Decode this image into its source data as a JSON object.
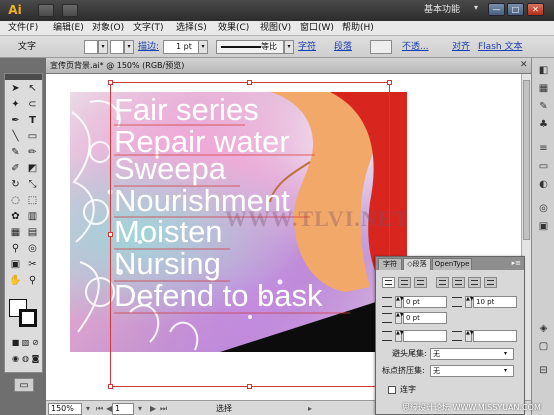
{
  "app": {
    "logo": "Ai",
    "workspace": "基本功能",
    "window_buttons": [
      "—",
      "□",
      "✕"
    ]
  },
  "menu": [
    "文件(F)",
    "编辑(E)",
    "对象(O)",
    "文字(T)",
    "选择(S)",
    "效果(C)",
    "视图(V)",
    "窗口(W)",
    "帮助(H)"
  ],
  "control_bar": {
    "mode_label": "文字",
    "stroke_label": "描边:",
    "stroke_weight": "1 pt",
    "stroke_style": "等比",
    "link_char": "字符",
    "link_para": "段落",
    "opacity_link": "不透...",
    "align_link": "对齐",
    "flash_link": "Flash 文本"
  },
  "document": {
    "tab_title": "宣传页背景.ai* @ 150% (RGB/预览)",
    "close": "✕"
  },
  "artwork": {
    "lines": [
      "Fair series",
      "Repair water",
      "Sweepa",
      "Nourishment",
      "Moisten",
      "Nursing",
      "Defend to bask"
    ],
    "watermark": "WWW.TLVI.NET",
    "colors": {
      "text": "#ffffff",
      "selection": "#d23a3a",
      "dress": "#d8261f",
      "skin": "#f2a868"
    }
  },
  "status_bar": {
    "zoom": "150%",
    "page": "1",
    "tool": "选择"
  },
  "paragraph_panel": {
    "tabs": [
      "字符",
      "◇段落",
      "OpenType"
    ],
    "menu_icon": "▸≡",
    "left_indent": "0 pt",
    "right_indent": "10 pt",
    "first_line_indent": "0 pt",
    "space_before": "",
    "space_after": "",
    "kinsoku_label": "避头尾集:",
    "kinsoku_value": "无",
    "mojikumi_label": "标点挤压集:",
    "mojikumi_value": "无",
    "hyphenate_label": "连字"
  },
  "footer_watermark": "思缘设计论坛  WWW.MISSYUAN.COM"
}
